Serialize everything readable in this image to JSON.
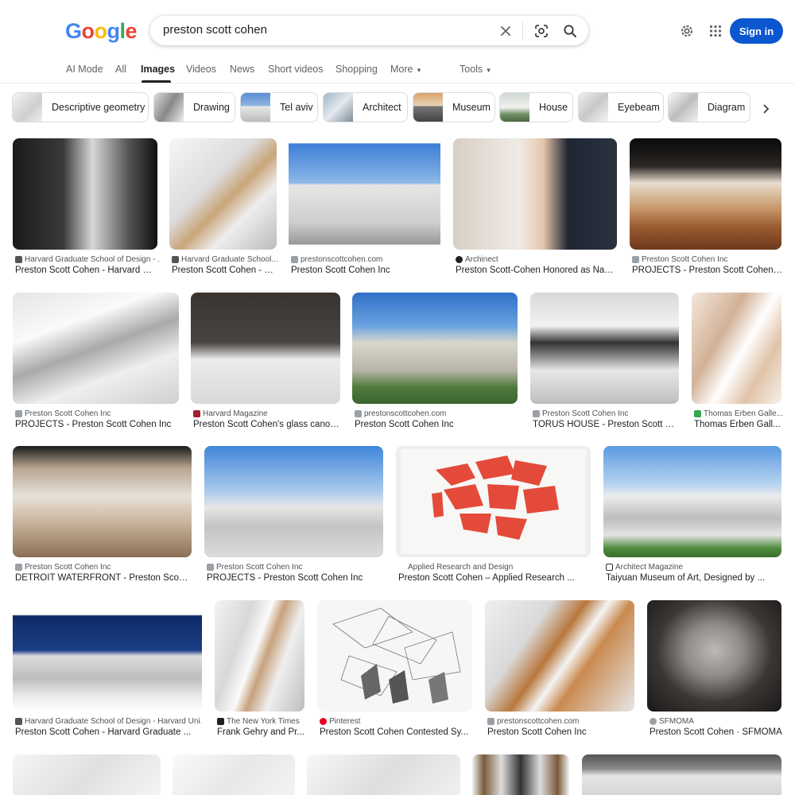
{
  "logo": {
    "text": [
      "G",
      "o",
      "o",
      "g",
      "l",
      "e"
    ],
    "colors": [
      "#4285f4",
      "#ea4335",
      "#fbbc05",
      "#4285f4",
      "#34a853",
      "#ea4335"
    ]
  },
  "search": {
    "query": "preston scott cohen"
  },
  "header": {
    "sign_in": "Sign in"
  },
  "tabs": [
    "AI Mode",
    "All",
    "Images",
    "Videos",
    "News",
    "Short videos",
    "Shopping",
    "More",
    "Tools"
  ],
  "chips": [
    "Descriptive geometry",
    "Drawing",
    "Tel aviv",
    "Architect",
    "Museum",
    "House",
    "Eyebeam",
    "Diagram"
  ],
  "results": [
    {
      "source": "Harvard Graduate School of Design - ...",
      "title": "Preston Scott Cohen - Harvard Gr..."
    },
    {
      "source": "Harvard Graduate School...",
      "title": "Preston Scott Cohen - H..."
    },
    {
      "source": "prestonscottcohen.com",
      "title": "Preston Scott Cohen Inc"
    },
    {
      "source": "Archinect",
      "title": "Preston Scott-Cohen Honored as Nati..."
    },
    {
      "source": "Preston Scott Cohen Inc",
      "title": "PROJECTS - Preston Scott Cohen Inc"
    },
    {
      "source": "Preston Scott Cohen Inc",
      "title": "PROJECTS - Preston Scott Cohen Inc"
    },
    {
      "source": "Harvard Magazine",
      "title": "Preston Scott Cohen's glass canop..."
    },
    {
      "source": "prestonscottcohen.com",
      "title": "Preston Scott Cohen Inc"
    },
    {
      "source": "Preston Scott Cohen Inc",
      "title": "TORUS HOUSE - Preston Scott Coh..."
    },
    {
      "source": "Thomas Erben Galle...",
      "title": "Thomas Erben Gall..."
    },
    {
      "source": "Preston Scott Cohen Inc",
      "title": "DETROIT WATERFRONT - Preston Scott ..."
    },
    {
      "source": "Preston Scott Cohen Inc",
      "title": "PROJECTS - Preston Scott Cohen Inc"
    },
    {
      "source": "Applied Research and Design",
      "title": "Preston Scott Cohen – Applied Research ..."
    },
    {
      "source": "Architect Magazine",
      "title": "Taiyuan Museum of Art, Designed by ..."
    },
    {
      "source": "Harvard Graduate School of Design - Harvard Uni...",
      "title": "Preston Scott Cohen - Harvard Graduate ..."
    },
    {
      "source": "The New York Times",
      "title": "Frank Gehry and Pr..."
    },
    {
      "source": "Pinterest",
      "title": "Preston Scott Cohen Contested Sy..."
    },
    {
      "source": "prestonscottcohen.com",
      "title": "Preston Scott Cohen Inc"
    },
    {
      "source": "SFMOMA",
      "title": "Preston Scott Cohen · SFMOMA"
    }
  ]
}
